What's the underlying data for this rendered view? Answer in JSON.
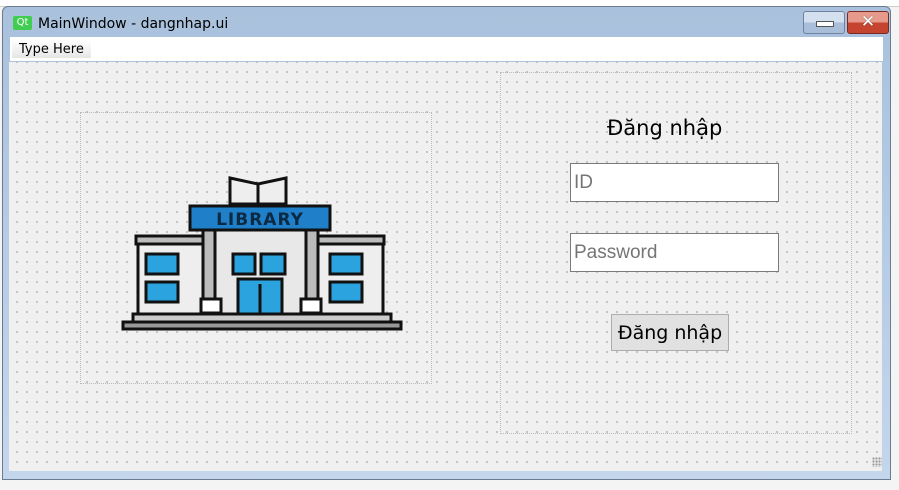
{
  "window": {
    "title": "MainWindow - dangnhap.ui",
    "app_icon": "Qt",
    "minimize_icon": "minimize-icon",
    "close_icon": "close-icon"
  },
  "menubar": {
    "items": [
      {
        "label": "Type Here"
      }
    ]
  },
  "logo": {
    "text": "LIBRARY",
    "colors": {
      "sign": "#1f7fc8",
      "windows": "#2aa3df"
    }
  },
  "login": {
    "heading": "Đăng nhập",
    "id_placeholder": "ID",
    "password_placeholder": "Password",
    "submit_label": "Đăng nhập"
  }
}
